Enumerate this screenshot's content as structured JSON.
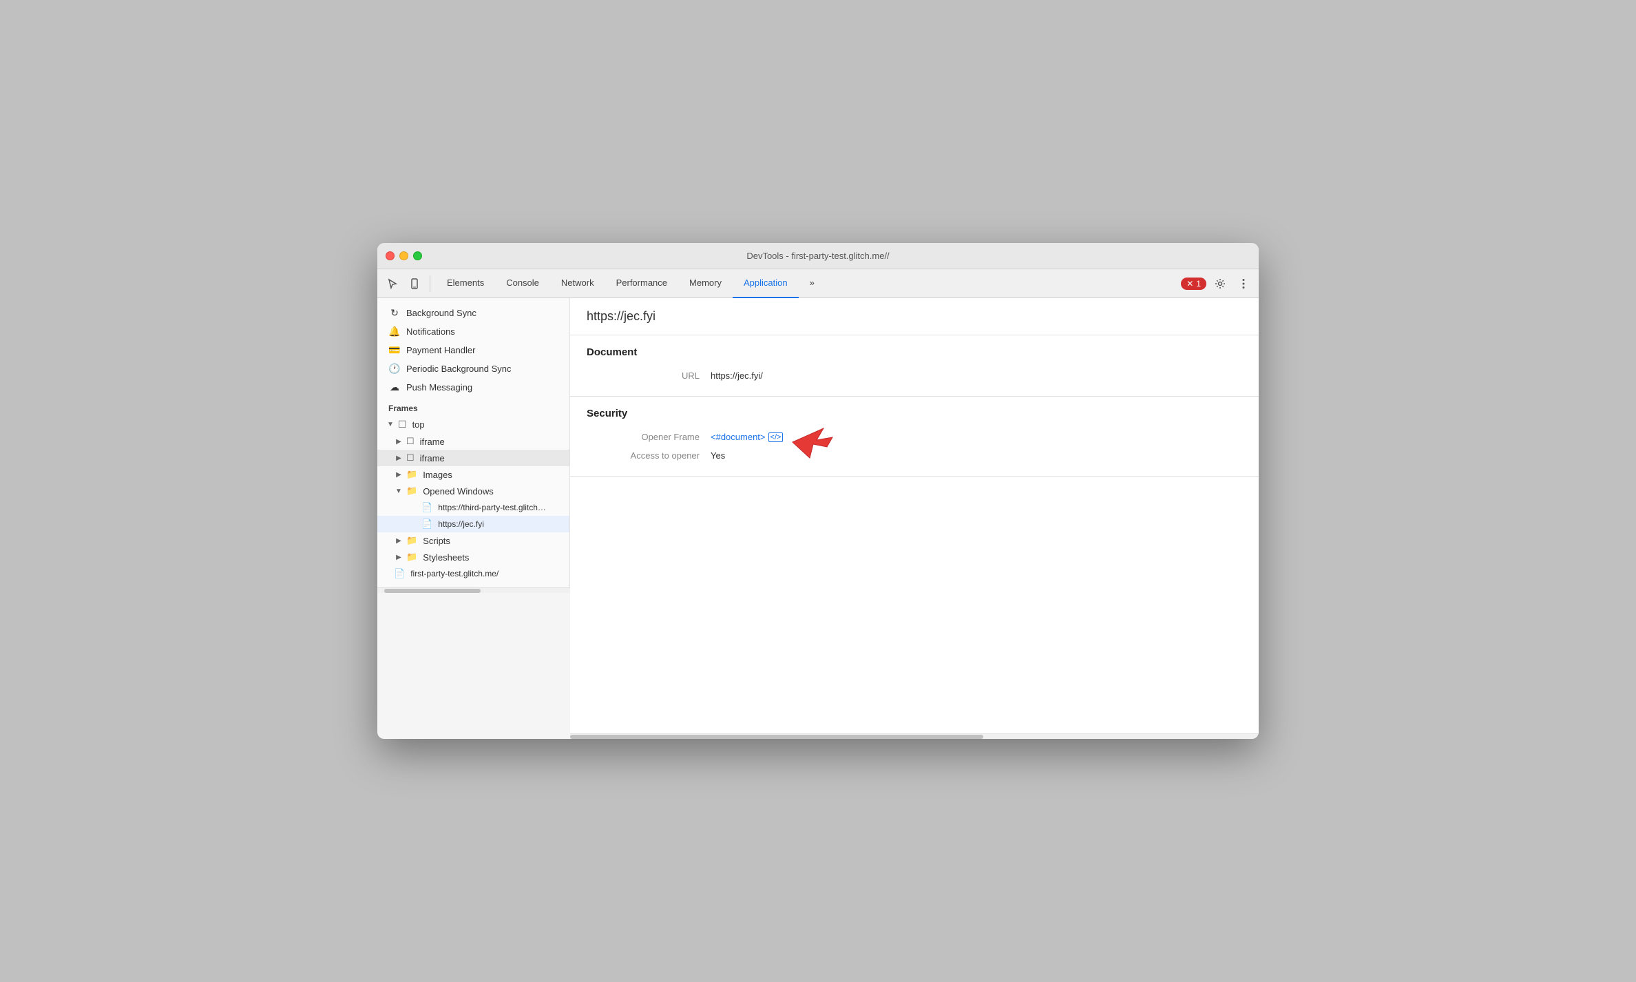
{
  "window": {
    "title": "DevTools - first-party-test.glitch.me//"
  },
  "toolbar": {
    "tabs": [
      {
        "id": "elements",
        "label": "Elements",
        "active": false
      },
      {
        "id": "console",
        "label": "Console",
        "active": false
      },
      {
        "id": "network",
        "label": "Network",
        "active": false
      },
      {
        "id": "performance",
        "label": "Performance",
        "active": false
      },
      {
        "id": "memory",
        "label": "Memory",
        "active": false
      },
      {
        "id": "application",
        "label": "Application",
        "active": true
      }
    ],
    "more_label": "»",
    "error_count": "1"
  },
  "sidebar": {
    "items": [
      {
        "id": "background-sync",
        "icon": "↻",
        "label": "Background Sync",
        "indent": 0
      },
      {
        "id": "notifications",
        "icon": "🔔",
        "label": "Notifications",
        "indent": 0
      },
      {
        "id": "payment-handler",
        "icon": "💳",
        "label": "Payment Handler",
        "indent": 0
      },
      {
        "id": "periodic-bg-sync",
        "icon": "🕐",
        "label": "Periodic Background Sync",
        "indent": 0
      },
      {
        "id": "push-messaging",
        "icon": "☁",
        "label": "Push Messaging",
        "indent": 0
      }
    ],
    "frames_section": "Frames",
    "frames_tree": [
      {
        "id": "top",
        "label": "top",
        "indent": 0,
        "arrow": "expanded",
        "icon": "frame"
      },
      {
        "id": "iframe1",
        "label": "iframe",
        "indent": 1,
        "arrow": "collapsed",
        "icon": "frame"
      },
      {
        "id": "iframe2",
        "label": "iframe",
        "indent": 1,
        "arrow": "collapsed",
        "icon": "frame",
        "highlighted": true
      },
      {
        "id": "images",
        "label": "Images",
        "indent": 1,
        "arrow": "collapsed",
        "icon": "folder"
      },
      {
        "id": "opened-windows",
        "label": "Opened Windows",
        "indent": 1,
        "arrow": "expanded",
        "icon": "folder"
      },
      {
        "id": "third-party-url",
        "label": "https://third-party-test.glitch.me/po",
        "indent": 3,
        "arrow": "empty",
        "icon": "doc"
      },
      {
        "id": "jec-fyi",
        "label": "https://jec.fyi",
        "indent": 3,
        "arrow": "empty",
        "icon": "doc",
        "selected": true
      },
      {
        "id": "scripts",
        "label": "Scripts",
        "indent": 1,
        "arrow": "collapsed",
        "icon": "folder"
      },
      {
        "id": "stylesheets",
        "label": "Stylesheets",
        "indent": 1,
        "arrow": "collapsed",
        "icon": "folder"
      },
      {
        "id": "first-party-test",
        "label": "first-party-test.glitch.me/",
        "indent": 1,
        "arrow": "empty",
        "icon": "doc"
      }
    ]
  },
  "main": {
    "header_url": "https://jec.fyi",
    "document_section": "Document",
    "url_label": "URL",
    "url_value": "https://jec.fyi/",
    "security_section": "Security",
    "opener_frame_label": "Opener Frame",
    "opener_frame_link": "<#document>",
    "access_label": "Access to opener",
    "access_value": "Yes"
  }
}
